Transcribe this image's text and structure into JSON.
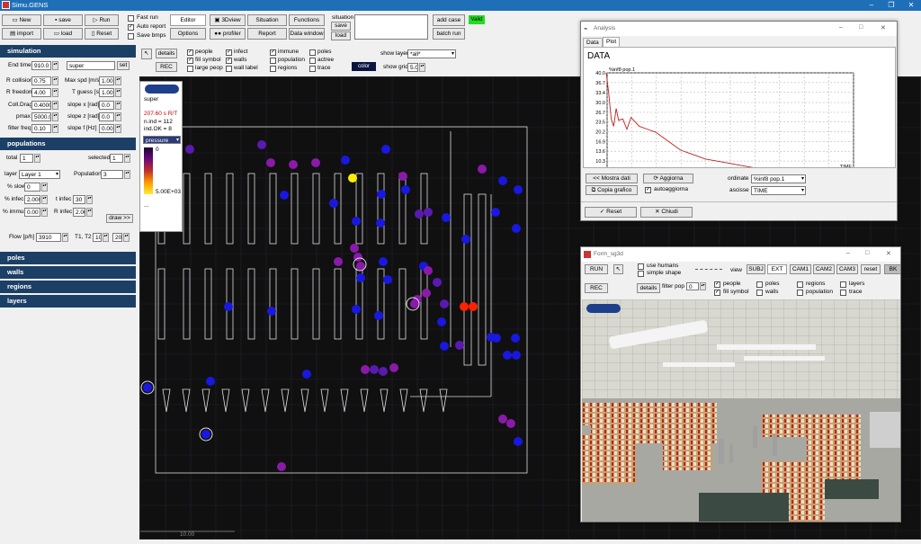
{
  "app": {
    "title": "Simu.GENS",
    "controls": [
      "–",
      "❐",
      "✕"
    ]
  },
  "toolbar": {
    "new": "New",
    "save": "save",
    "run": "Run",
    "import": "import",
    "load": "load",
    "reset": "Reset",
    "fast_run": "Fast run",
    "auto_report": "Auto report",
    "save_bmps": "Save bmps",
    "editor": "Editor",
    "options": "Options",
    "view3d": "3Dview",
    "profiler": "profiler",
    "situation": "Situation",
    "report": "Report",
    "functions": "Functions",
    "data_window": "Data window",
    "situation_lbl": "situation",
    "sit_save": "save",
    "sit_load": "load",
    "add_case": "add case",
    "batch_run": "batch run",
    "valid": "Valid"
  },
  "simulation": {
    "header": "simulation",
    "end_time_lbl": "End time",
    "end_time": "910.0",
    "scenario": "super",
    "set": "set",
    "r_collision_lbl": "R collision",
    "r_collision": "0.75",
    "max_spd_lbl": "Max spd [m/s]",
    "max_spd": "1.00",
    "r_freedom_lbl": "R freedom",
    "r_freedom": "4.00",
    "t_guess_lbl": "T guess [s]",
    "t_guess": "1.00",
    "coll_drag_lbl": "Coll.Drag",
    "coll_drag": "0.4000",
    "slope_x_lbl": "slope x [rad]",
    "slope_x": "0.0",
    "pmax_lbl": "pmax",
    "pmax": "5000.0",
    "slope_z_lbl": "slope z [rad]",
    "slope_z": "0.0",
    "filter_freq_lbl": "filter freq",
    "filter_freq": "0.10",
    "slope_f_lbl": "slope f [Hz]",
    "slope_f": "0.00"
  },
  "populations": {
    "header": "populations",
    "total_lbl": "total",
    "total": "1",
    "selected_lbl": "selected",
    "selected": "1",
    "layer_lbl": "layer",
    "layer": "Layer 1",
    "population_lbl": "Population",
    "population": "3",
    "slow_lbl": "% slow",
    "slow": "0",
    "infec_lbl": "% infec",
    "infec": "2.000",
    "t_infec_lbl": "t infec",
    "t_infec": "30",
    "immun_lbl": "% immun",
    "immun": "0.00",
    "r_infec_lbl": "R infec",
    "r_infec": "2.00",
    "draw": "draw >>",
    "flow_lbl": "Flow [p/h]",
    "flow": "3910",
    "t1t2_lbl": "T1, T2",
    "t1": "10",
    "t2": "20"
  },
  "sections": {
    "poles": "poles",
    "walls": "walls",
    "regions": "regions",
    "layers": "layers"
  },
  "display_opts": {
    "details": "details",
    "rec": "REC",
    "people": "people",
    "fill_symbol": "fill symbol",
    "large_peop": "large peop",
    "infect": "infect",
    "walls": "walls",
    "wall_label": "wall label",
    "immune": "immune",
    "population": "population",
    "regions": "regions",
    "poles": "poles",
    "actree": "actree",
    "trace": "trace",
    "color": "color",
    "show_layer_lbl": "show layer",
    "show_layer": "*all*",
    "show_grid_lbl": "show grid",
    "show_grid": "5.0"
  },
  "legend": {
    "name": "super",
    "time": "207.60 s  R/T",
    "n_ind": "n.ind = 112",
    "ind_ok": "ind.OK = 8",
    "mode": "pressure",
    "max": "0",
    "min": "5.00E+03",
    "dots": "..."
  },
  "scale": {
    "label": "10.00"
  },
  "colors": {
    "titlebar": "#1e6fb8",
    "section": "#1c3f66",
    "valid": "#22dd22",
    "plot_line": "#c02020",
    "blue_dot": "#1818e0",
    "violet_dot": "#5a1ab0",
    "purple_dot": "#8a1aa8",
    "red_dot": "#ff2200",
    "yellow_dot": "#ffee00"
  },
  "analysis": {
    "title": "Analysis",
    "tabs": [
      "Data",
      "Plot"
    ],
    "data_title": "DATA",
    "series_label": "%inf8 pop.1",
    "xlabel": "TIME",
    "mostra": "<< Mostra dati",
    "aggiorna": "Aggiorna",
    "copia": "Copia grafico",
    "autoaggiorna": "autoaggiorna",
    "ordinate_lbl": "ordinate",
    "ordinate": "%inf8 pop.1",
    "ascisse_lbl": "ascisse",
    "ascisse": "TIME",
    "reset": "Reset",
    "chiudi": "Chiudi"
  },
  "chart_data": {
    "type": "line",
    "title": "DATA",
    "series": [
      {
        "name": "%inf8 pop.1",
        "x": [
          0,
          3,
          6,
          9,
          12,
          15,
          20,
          25,
          30,
          40,
          50,
          60,
          70,
          80,
          90,
          100,
          110,
          120,
          130,
          140,
          150,
          160,
          170,
          180,
          190,
          200,
          210
        ],
        "y": [
          40.0,
          33.0,
          24.5,
          22.0,
          28.0,
          24.0,
          24.5,
          21.0,
          25.0,
          22.0,
          21.0,
          20.0,
          18.0,
          16.0,
          14.0,
          13.0,
          12.0,
          11.0,
          10.5,
          10.0,
          9.5,
          9.0,
          8.5,
          8.0,
          7.6,
          7.3,
          7.0
        ]
      }
    ],
    "xlabel": "TIME",
    "ylabel": "",
    "xticks": [
      1,
      30.9,
      60.8,
      90.7,
      120.6,
      150.5,
      180.4,
      210.3,
      240.2,
      270.1,
      300
    ],
    "yticks": [
      "40.0",
      "36.7",
      "33.4",
      "30.0",
      "26.7",
      "23.5",
      "20.2",
      "16.9",
      "13.6",
      "10.3",
      "7"
    ],
    "xlim": [
      1,
      300
    ],
    "ylim": [
      7,
      40
    ],
    "grid": true
  },
  "form3d": {
    "title": "Form_sg3d",
    "run": "RUN",
    "use_humans": "use humans",
    "simple_shape": "simple shape",
    "view": "view",
    "subj": "SUBJ",
    "ext": "EXT",
    "cam1": "CAM1",
    "cam2": "CAM2",
    "cam3": "CAM3",
    "reset": "reset",
    "bk": "BK",
    "rec": "REC",
    "details": "details",
    "filter_pop": "filter pop",
    "filter_val": "0",
    "people": "people",
    "fill_symbol": "fill symbol",
    "poles": "poles",
    "walls": "walls",
    "regions": "regions",
    "population": "population",
    "layers": "layers",
    "trace": "trace"
  }
}
